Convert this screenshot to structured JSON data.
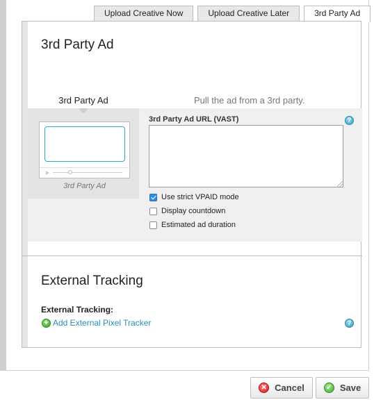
{
  "tabs": [
    {
      "label": "Upload Creative Now"
    },
    {
      "label": "Upload Creative Later"
    },
    {
      "label": "3rd Party Ad",
      "active": true
    }
  ],
  "section1": {
    "title": "3rd Party Ad",
    "ad_type_label": "3rd Party Ad",
    "description": "Pull the ad from a 3rd party.",
    "thumbnail_caption": "3rd Party Ad",
    "url_field": {
      "label": "3rd Party Ad URL (VAST)",
      "value": "",
      "placeholder": ""
    },
    "help_icon": "question-icon",
    "options": [
      {
        "label": "Use strict VPAID mode",
        "checked": true
      },
      {
        "label": "Display countdown",
        "checked": false
      },
      {
        "label": "Estimated ad duration",
        "checked": false
      }
    ]
  },
  "section2": {
    "title": "External Tracking",
    "tracking_label": "External Tracking:",
    "add_link": "Add External Pixel Tracker",
    "add_icon": "plus-circle-icon",
    "help_icon": "question-icon"
  },
  "footer": {
    "cancel_label": "Cancel",
    "save_label": "Save",
    "cancel_icon": "close-circle-icon",
    "save_icon": "check-circle-icon"
  },
  "colors": {
    "accent": "#2a8fb5",
    "checkbox_checked": "#2f8de4",
    "thumbnail_border": "#2aa7c9",
    "cancel": "#d31d1d",
    "save": "#3fae2a"
  }
}
